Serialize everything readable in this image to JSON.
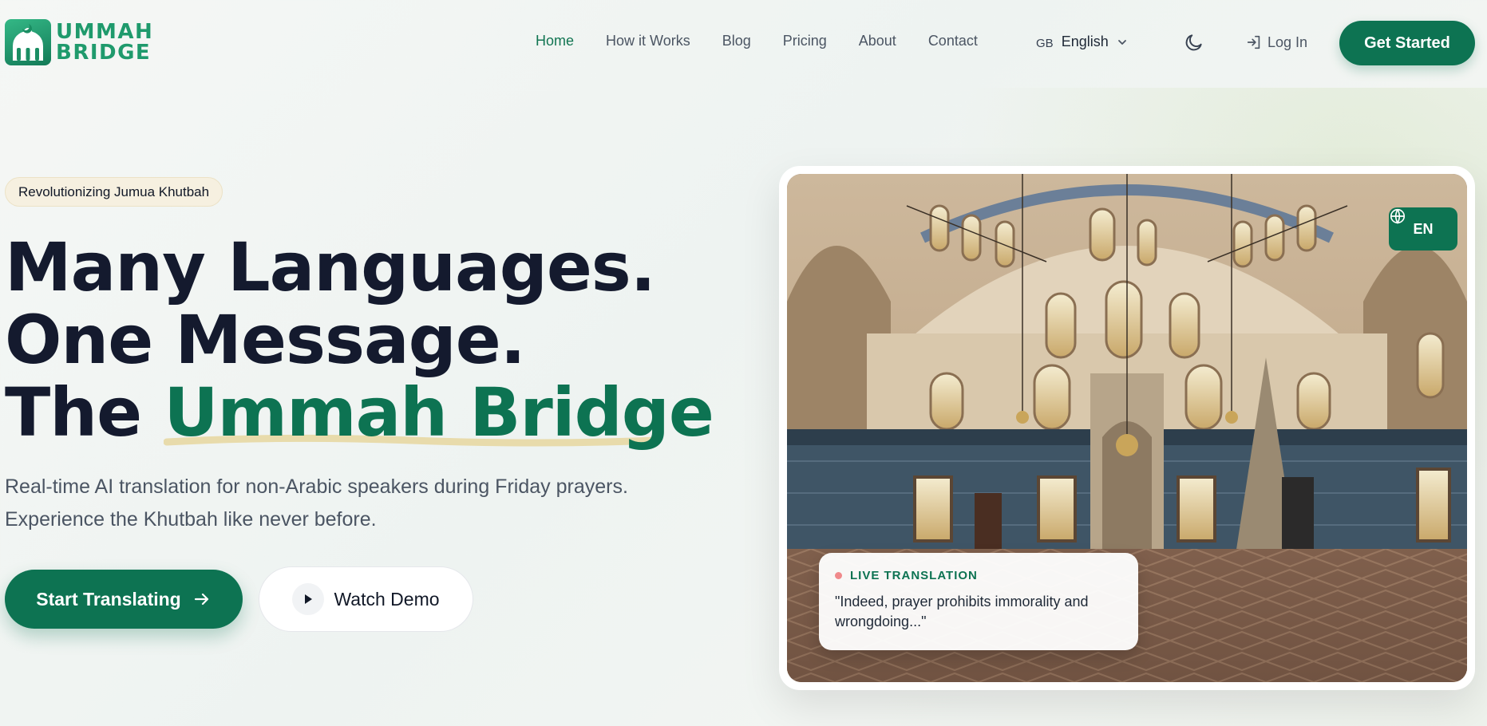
{
  "brand": {
    "line1": "UMMAH",
    "line2": "BRIDGE"
  },
  "nav": {
    "links": [
      {
        "label": "Home",
        "active": true
      },
      {
        "label": "How it Works",
        "active": false
      },
      {
        "label": "Blog",
        "active": false
      },
      {
        "label": "Pricing",
        "active": false
      },
      {
        "label": "About",
        "active": false
      },
      {
        "label": "Contact",
        "active": false
      }
    ],
    "language": {
      "flag": "GB",
      "label": "English"
    },
    "login_label": "Log In",
    "cta_label": "Get Started"
  },
  "hero": {
    "badge": "Revolutionizing Jumua Khutbah",
    "headline_line1": "Many Languages.",
    "headline_line2": "One Message.",
    "headline_line3_prefix": "The ",
    "headline_line3_accent": "Ummah Bridge",
    "subtitle_line1": "Real-time AI translation for non-Arabic speakers during Friday prayers.",
    "subtitle_line2": "Experience the Khutbah like never before.",
    "primary_button": "Start Translating",
    "secondary_button": "Watch Demo"
  },
  "preview": {
    "language_pill": "EN",
    "live_label": "LIVE TRANSLATION",
    "live_quote": "\"Indeed, prayer prohibits immorality and wrongdoing...\""
  },
  "colors": {
    "brand_green": "#0d7352",
    "headline_dark": "#141a2e",
    "badge_bg": "#f6f0e0",
    "live_dot": "#f0898b"
  },
  "icons": [
    "mosque-logo-icon",
    "chevron-down-icon",
    "moon-icon",
    "login-icon",
    "arrow-right-icon",
    "play-icon",
    "globe-icon"
  ]
}
